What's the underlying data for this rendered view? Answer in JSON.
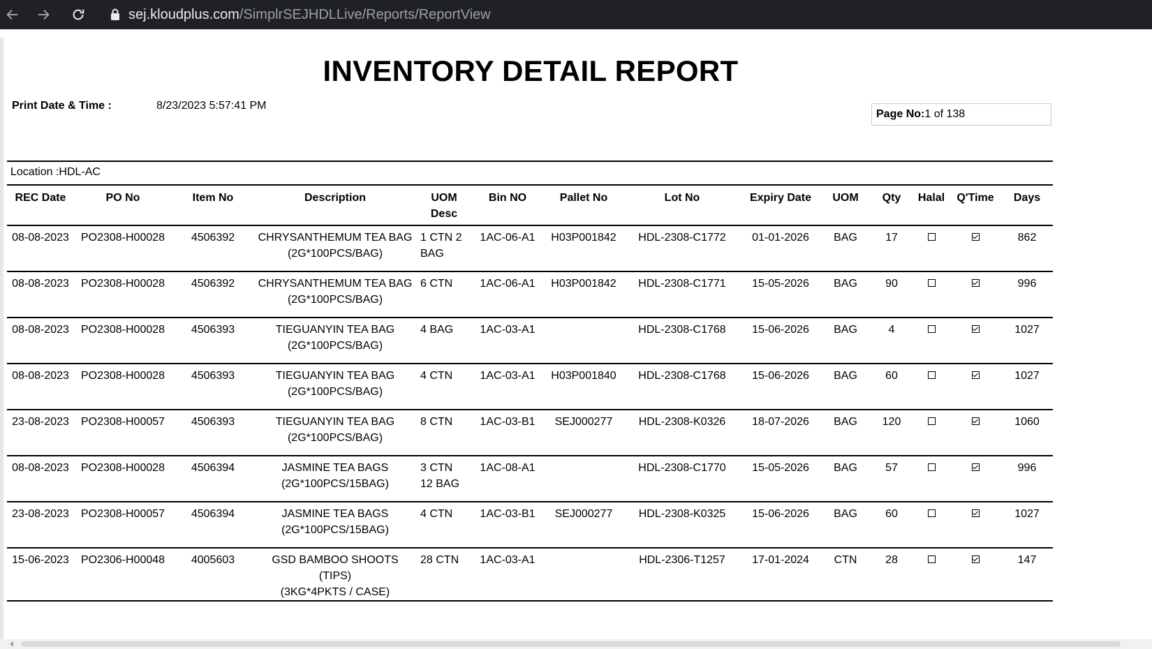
{
  "browser": {
    "url_host": "sej.kloudplus.com",
    "url_path": "/SimplrSEJHDLLive/Reports/ReportView"
  },
  "report": {
    "title": "INVENTORY DETAIL REPORT",
    "print_label": "Print Date & Time :",
    "print_value": "8/23/2023 5:57:41 PM",
    "page_label": "Page No:",
    "page_value": "1 of 138",
    "location": "Location :HDL-AC"
  },
  "table": {
    "headers": [
      "REC Date",
      "PO No",
      "Item No",
      "Description",
      "UOM Desc",
      "Bin NO",
      "Pallet No",
      "Lot No",
      "Expiry Date",
      "UOM",
      "Qty",
      "Halal",
      "Q'Time",
      "Days"
    ],
    "rows": [
      {
        "rec_date": "08-08-2023",
        "po_no": "PO2308-H00028",
        "item_no": "4506392",
        "desc1": "CHRYSANTHEMUM TEA BAG",
        "desc2": "(2G*100PCS/BAG)",
        "uom_desc1": "1 CTN 2",
        "uom_desc2": "BAG",
        "bin_no": "1AC-06-A1",
        "pallet_no": "H03P001842",
        "lot_no": "HDL-2308-C1772",
        "expiry": "01-01-2026",
        "uom": "BAG",
        "qty": "17",
        "halal": false,
        "qtime": true,
        "days": "862"
      },
      {
        "rec_date": "08-08-2023",
        "po_no": "PO2308-H00028",
        "item_no": "4506392",
        "desc1": "CHRYSANTHEMUM TEA BAG",
        "desc2": "(2G*100PCS/BAG)",
        "uom_desc1": "6 CTN",
        "uom_desc2": "",
        "bin_no": "1AC-06-A1",
        "pallet_no": "H03P001842",
        "lot_no": "HDL-2308-C1771",
        "expiry": "15-05-2026",
        "uom": "BAG",
        "qty": "90",
        "halal": false,
        "qtime": true,
        "days": "996"
      },
      {
        "rec_date": "08-08-2023",
        "po_no": "PO2308-H00028",
        "item_no": "4506393",
        "desc1": "TIEGUANYIN TEA BAG",
        "desc2": "(2G*100PCS/BAG)",
        "uom_desc1": "4 BAG",
        "uom_desc2": "",
        "bin_no": "1AC-03-A1",
        "pallet_no": "",
        "lot_no": "HDL-2308-C1768",
        "expiry": "15-06-2026",
        "uom": "BAG",
        "qty": "4",
        "halal": false,
        "qtime": true,
        "days": "1027"
      },
      {
        "rec_date": "08-08-2023",
        "po_no": "PO2308-H00028",
        "item_no": "4506393",
        "desc1": "TIEGUANYIN TEA BAG",
        "desc2": "(2G*100PCS/BAG)",
        "uom_desc1": "4 CTN",
        "uom_desc2": "",
        "bin_no": "1AC-03-A1",
        "pallet_no": "H03P001840",
        "lot_no": "HDL-2308-C1768",
        "expiry": "15-06-2026",
        "uom": "BAG",
        "qty": "60",
        "halal": false,
        "qtime": true,
        "days": "1027"
      },
      {
        "rec_date": "23-08-2023",
        "po_no": "PO2308-H00057",
        "item_no": "4506393",
        "desc1": "TIEGUANYIN TEA BAG",
        "desc2": "(2G*100PCS/BAG)",
        "uom_desc1": "8 CTN",
        "uom_desc2": "",
        "bin_no": "1AC-03-B1",
        "pallet_no": "SEJ000277",
        "lot_no": "HDL-2308-K0326",
        "expiry": "18-07-2026",
        "uom": "BAG",
        "qty": "120",
        "halal": false,
        "qtime": true,
        "days": "1060"
      },
      {
        "rec_date": "08-08-2023",
        "po_no": "PO2308-H00028",
        "item_no": "4506394",
        "desc1": "JASMINE TEA BAGS",
        "desc2": "(2G*100PCS/15BAG)",
        "uom_desc1": "3 CTN",
        "uom_desc2": "12 BAG",
        "bin_no": "1AC-08-A1",
        "pallet_no": "",
        "lot_no": "HDL-2308-C1770",
        "expiry": "15-05-2026",
        "uom": "BAG",
        "qty": "57",
        "halal": false,
        "qtime": true,
        "days": "996"
      },
      {
        "rec_date": "23-08-2023",
        "po_no": "PO2308-H00057",
        "item_no": "4506394",
        "desc1": "JASMINE TEA BAGS",
        "desc2": "(2G*100PCS/15BAG)",
        "uom_desc1": "4 CTN",
        "uom_desc2": "",
        "bin_no": "1AC-03-B1",
        "pallet_no": "SEJ000277",
        "lot_no": "HDL-2308-K0325",
        "expiry": "15-06-2026",
        "uom": "BAG",
        "qty": "60",
        "halal": false,
        "qtime": true,
        "days": "1027"
      },
      {
        "rec_date": "15-06-2023",
        "po_no": "PO2306-H00048",
        "item_no": "4005603",
        "desc1": "GSD BAMBOO SHOOTS (TIPS)",
        "desc2": "(3KG*4PKTS / CASE)",
        "uom_desc1": "28 CTN",
        "uom_desc2": "",
        "bin_no": "1AC-03-A1",
        "pallet_no": "",
        "lot_no": "HDL-2306-T1257",
        "expiry": "17-01-2024",
        "uom": "CTN",
        "qty": "28",
        "halal": false,
        "qtime": true,
        "days": "147"
      }
    ]
  }
}
